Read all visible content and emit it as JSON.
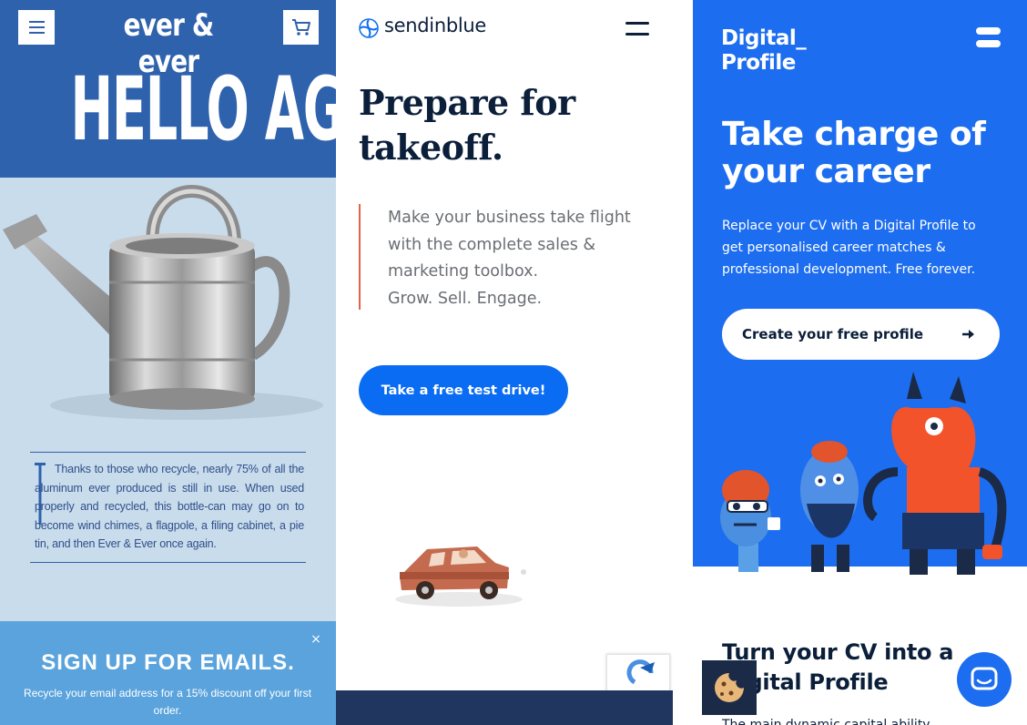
{
  "panels": {
    "ever": {
      "logo": "ever & ever",
      "headline": "HELLO AGAIN",
      "body": "Thanks to those who recycle, nearly 75% of all the aluminum ever produced is still in use. When used properly and recycled, this bottle-can may go on to become wind chimes, a flagpole, a filing cabinet, a pie tin, and then Ever & Ever once again.",
      "signup_title": "SIGN UP FOR EMAILS.",
      "signup_text": "Recycle your email address for a 15% discount off your first order.",
      "close": "×",
      "icons": [
        "hamburger-menu-icon",
        "cart-icon",
        "watering-can-image",
        "close-icon"
      ],
      "colors": {
        "brand": "#2f62ad",
        "sky": "#c9dcec",
        "footer": "#5aa3dc"
      }
    },
    "sendinblue": {
      "logo": "sendinblue",
      "title_line1": "Prepare for",
      "title_line2": "takeoff.",
      "quote_line1": "Make your business take flight",
      "quote_line2": "with the complete sales &",
      "quote_line3": "marketing toolbox.",
      "quote_line4": "Grow. Sell. Engage.",
      "cta": "Take a free test drive!",
      "icons": [
        "sendinblue-logo-icon",
        "menu-icon",
        "car-illustration",
        "recaptcha-icon"
      ],
      "colors": {
        "accent": "#0a6cf2",
        "quote_bar": "#e0644a",
        "navy": "#0b1f3a",
        "footer": "#20365e"
      }
    },
    "digital_profile": {
      "logo_line1": "Digital_",
      "logo_line2": "Profile",
      "title_line1": "Take charge of",
      "title_line2": "your career",
      "description": "Replace your CV with a Digital Profile to get personalised career matches & professional development. Free forever.",
      "cta": "Create your free profile",
      "section_title_line1": "Turn your CV into a",
      "section_title_line2": "Digital Profile",
      "section_text": "The main dynamic capital ability",
      "icons": [
        "menu-icon",
        "arrow-right-icon",
        "monsters-illustration",
        "chat-icon",
        "cookie-icon"
      ],
      "colors": {
        "brand": "#1c6df0",
        "navy": "#0b1f3a",
        "orange": "#f2532a"
      }
    }
  }
}
